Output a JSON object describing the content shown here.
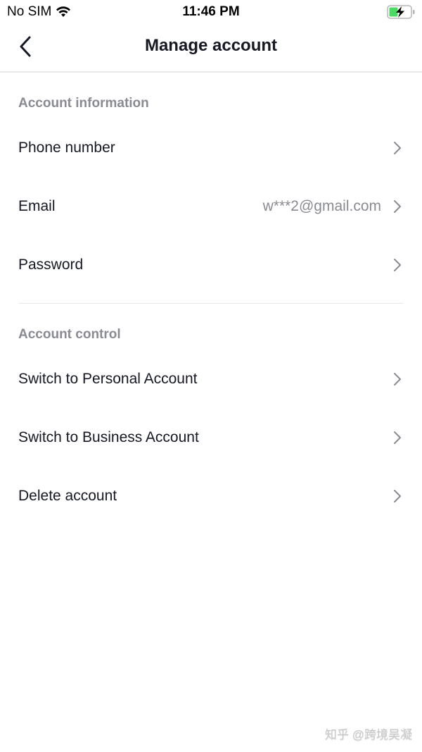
{
  "status_bar": {
    "carrier": "No SIM",
    "time": "11:46 PM",
    "wifi_icon": "wifi-icon",
    "battery_icon": "battery-charging-icon",
    "battery_color": "#4cd964"
  },
  "header": {
    "title": "Manage account",
    "back_icon": "chevron-left-icon"
  },
  "sections": [
    {
      "title": "Account information",
      "items": [
        {
          "label": "Phone number",
          "value": ""
        },
        {
          "label": "Email",
          "value": "w***2@gmail.com"
        },
        {
          "label": "Password",
          "value": ""
        }
      ]
    },
    {
      "title": "Account control",
      "items": [
        {
          "label": "Switch to Personal Account",
          "value": ""
        },
        {
          "label": "Switch to Business Account",
          "value": ""
        },
        {
          "label": "Delete account",
          "value": ""
        }
      ]
    }
  ],
  "watermark": "知乎 @跨境吴凝"
}
